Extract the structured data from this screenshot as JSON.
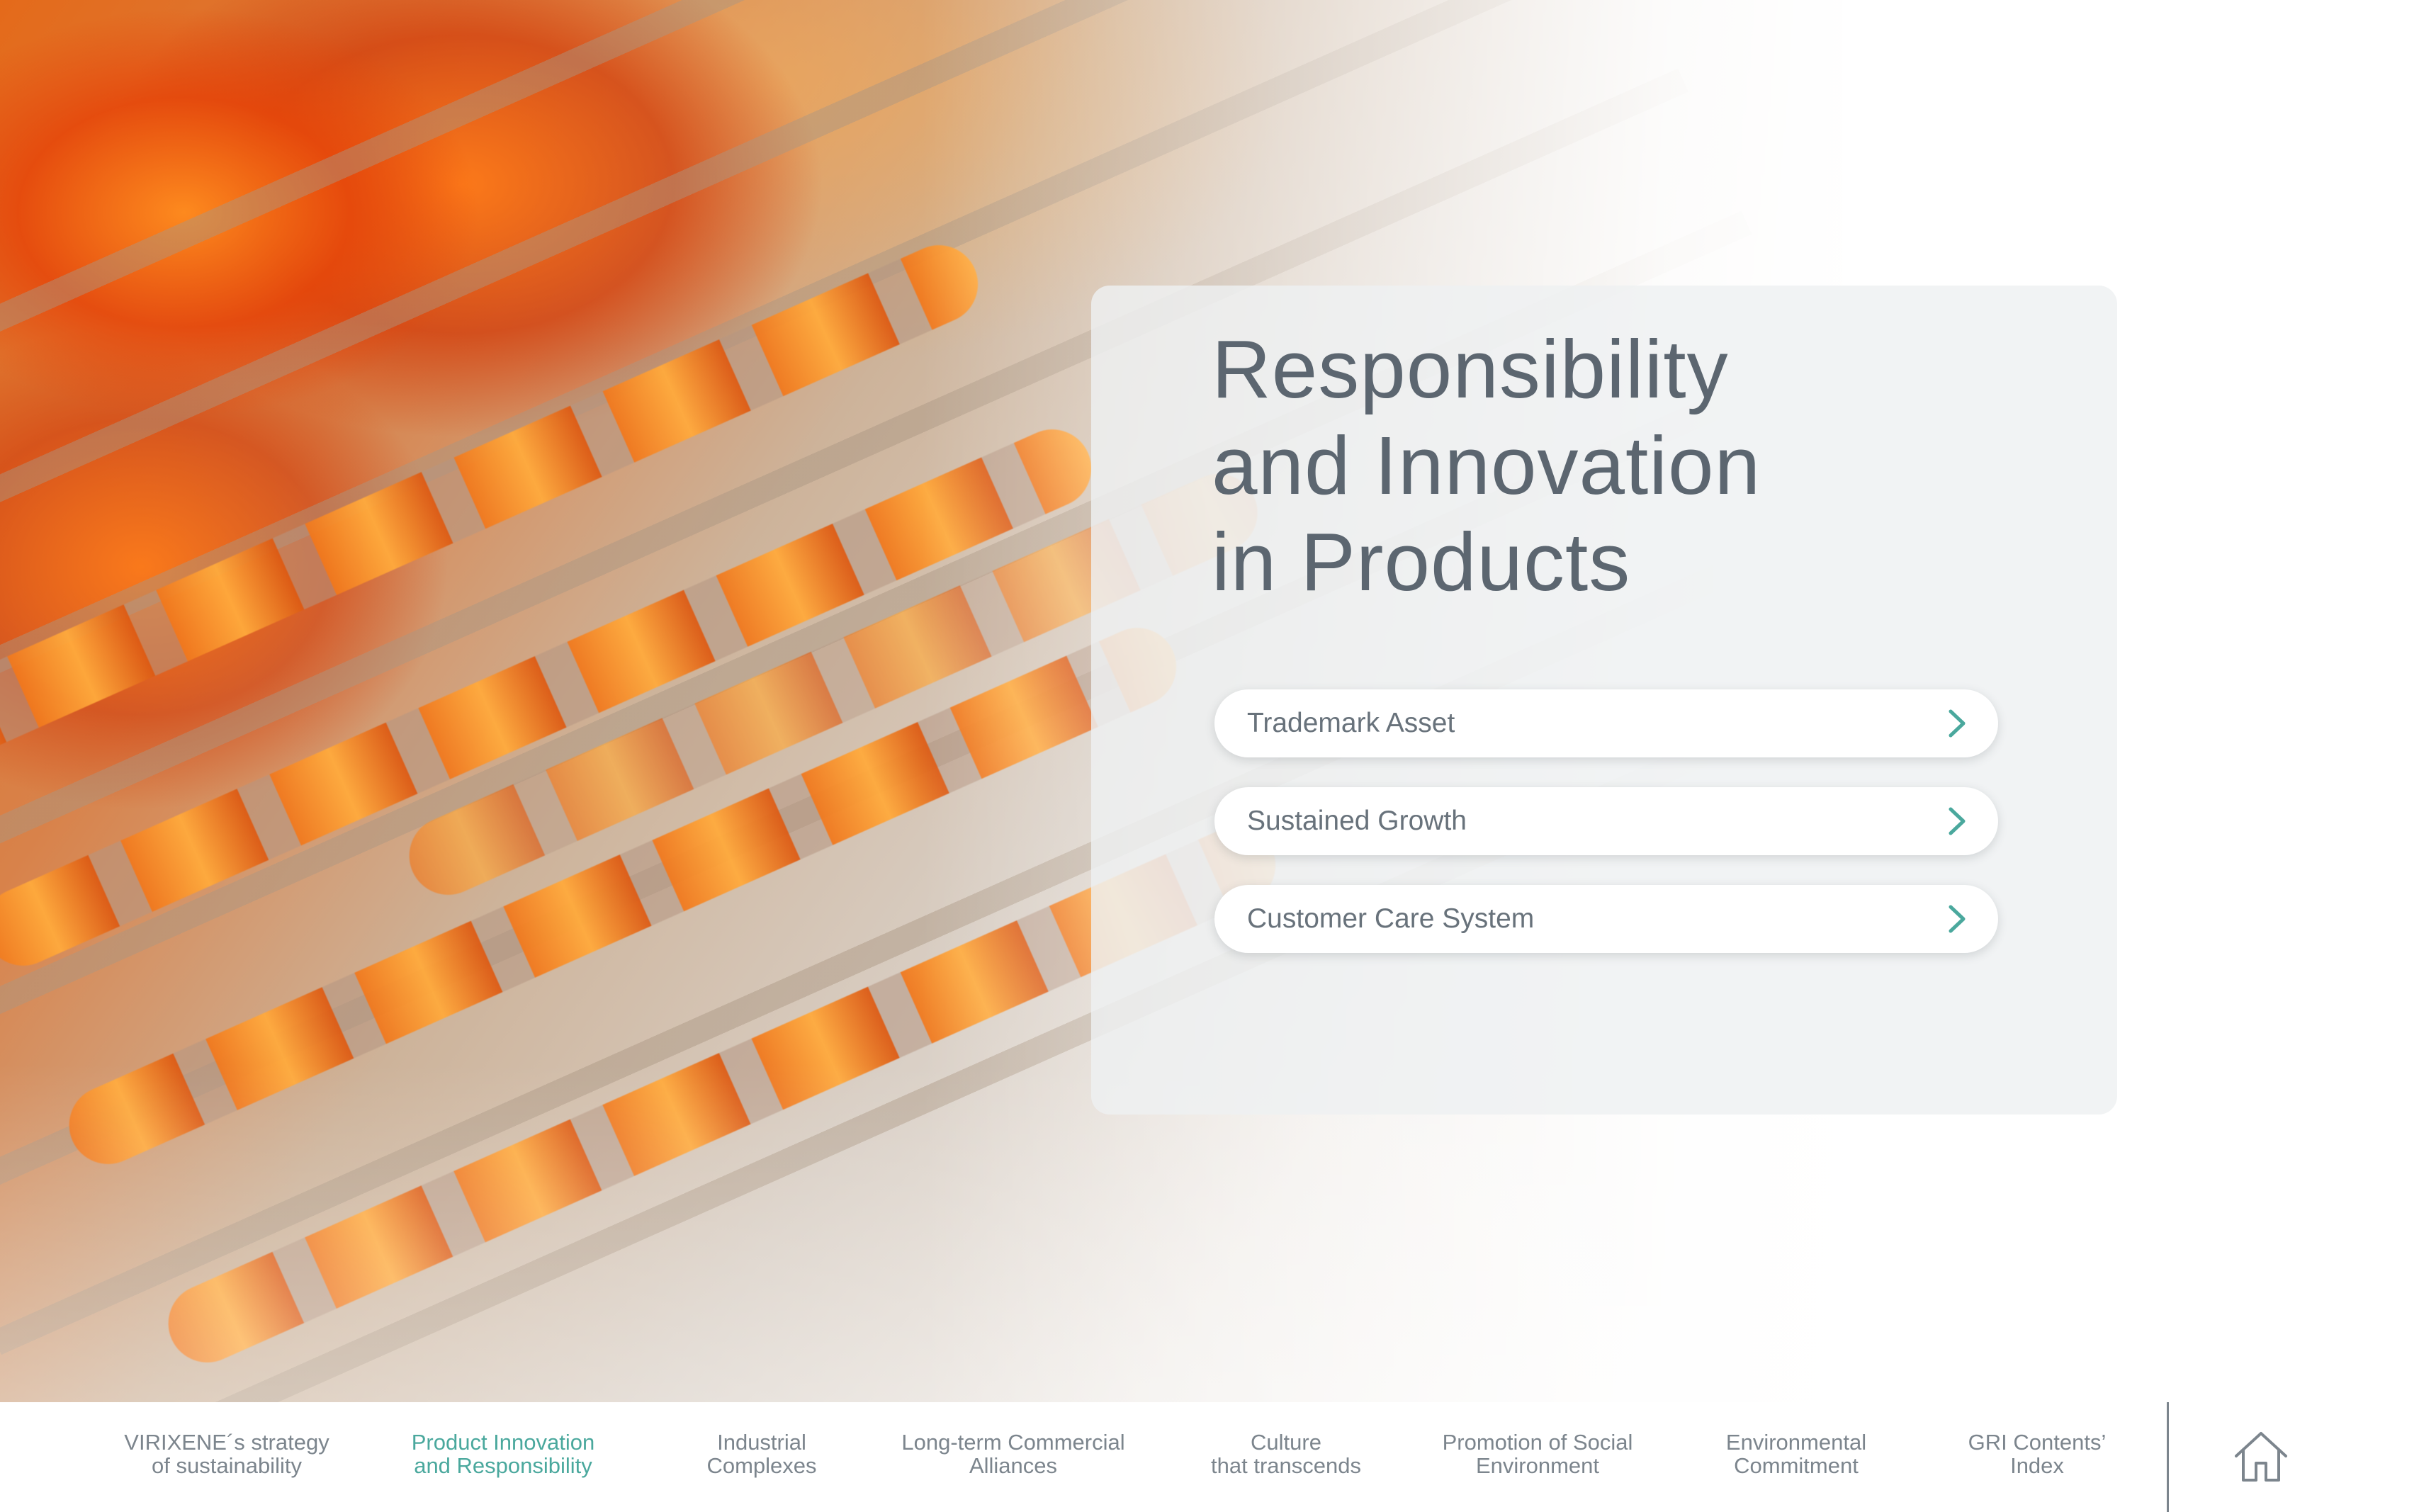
{
  "hero": {
    "title_lines": [
      "Responsibility",
      "and Innovation",
      "in Products"
    ],
    "image": "orange softgel capsules on tray"
  },
  "menu": {
    "items": [
      {
        "label": "Trademark Asset",
        "icon": "chevron-right-icon"
      },
      {
        "label": "Sustained Growth",
        "icon": "chevron-right-icon"
      },
      {
        "label": "Customer Care System",
        "icon": "chevron-right-icon"
      }
    ]
  },
  "bottom_nav": {
    "items": [
      {
        "line1": "VIRIXENE´s strategy",
        "line2": "of sustainability",
        "active": false
      },
      {
        "line1": "Product Innovation",
        "line2": "and Responsibility",
        "active": true
      },
      {
        "line1": "Industrial",
        "line2": "Complexes",
        "active": false
      },
      {
        "line1": "Long-term Commercial",
        "line2": "Alliances",
        "active": false
      },
      {
        "line1": "Culture",
        "line2": "that transcends",
        "active": false
      },
      {
        "line1": "Promotion of Social",
        "line2": "Environment",
        "active": false
      },
      {
        "line1": "Environmental",
        "line2": "Commitment",
        "active": false
      },
      {
        "line1": "GRI Contents’",
        "line2": "Index",
        "active": false
      }
    ],
    "home_icon": "home-icon"
  },
  "colors": {
    "accent": "#4aa89d",
    "text": "#5c6670",
    "nav_text": "#7c858d",
    "panel": "#eef0f2"
  }
}
